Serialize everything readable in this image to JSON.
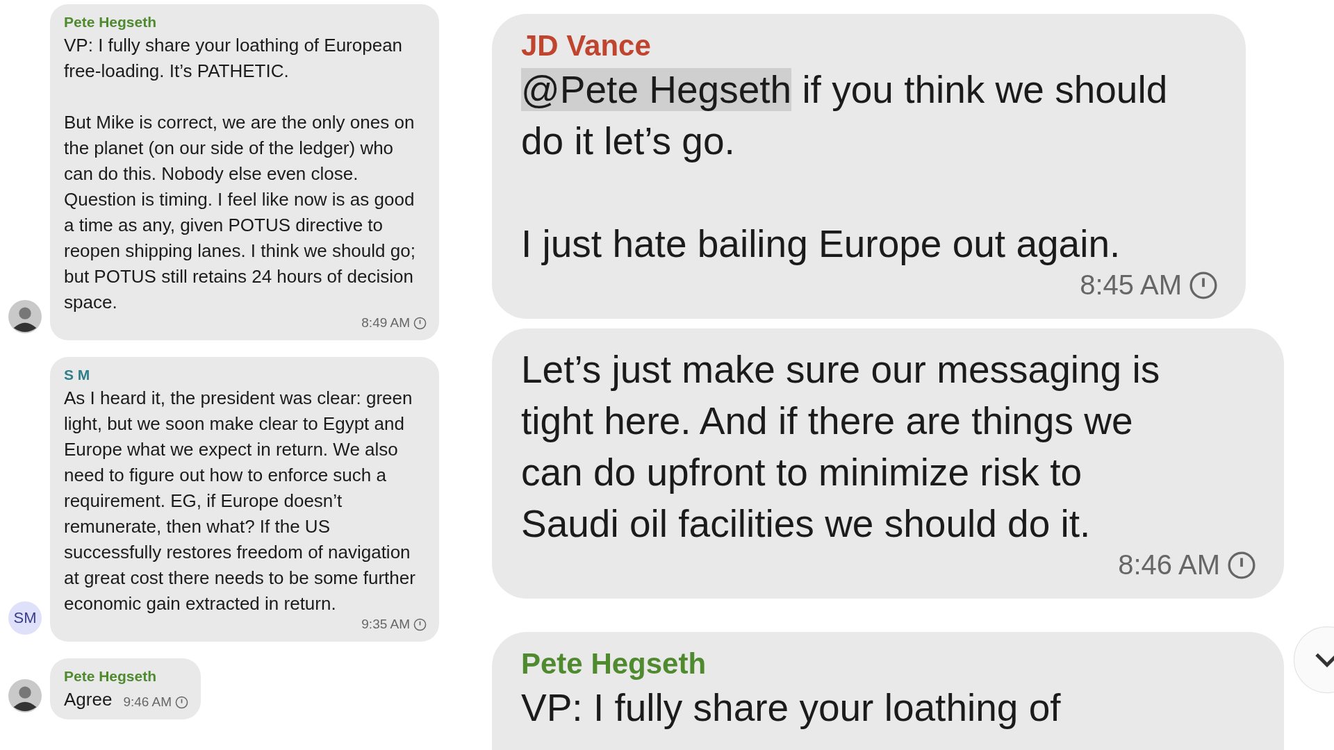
{
  "left_panel": {
    "messages": [
      {
        "sender": "Pete Hegseth",
        "color": "#4f8a2f",
        "paragraphs": [
          "VP: I fully share your loathing of European free-loading. It’s PATHETIC.",
          "But Mike is correct, we are the only ones on the planet (on our side of the ledger) who can do this. Nobody else even close. Question is timing. I feel like now is as good a time as any, given POTUS directive to reopen shipping lanes. I think we should go; but POTUS still retains 24 hours of decision space."
        ],
        "time": "8:49 AM",
        "avatar": {
          "kind": "photo"
        }
      },
      {
        "sender": "S M",
        "color": "#2f7f8a",
        "paragraphs": [
          "As I heard it, the president was clear: green light, but we soon make clear to Egypt and Europe what we expect in return. We also need to figure out how to enforce such a requirement. EG, if Europe doesn’t remunerate, then what? If the US successfully restores freedom of navigation at great cost there needs to be some further economic gain extracted in return."
        ],
        "time": "9:35 AM",
        "avatar": {
          "kind": "initials",
          "initials": "SM"
        }
      },
      {
        "sender": "Pete Hegseth",
        "color": "#4f8a2f",
        "paragraphs": [
          "Agree"
        ],
        "time": "9:46 AM",
        "avatar": {
          "kind": "photo"
        }
      }
    ]
  },
  "right_panel": {
    "messages": [
      {
        "sender": "JD Vance",
        "color": "#c0452f",
        "mention": "@Pete Hegseth",
        "paragraphs": [
          "if you think we should do it let’s go.",
          "I just hate bailing Europe out again."
        ],
        "time": "8:45 AM"
      },
      {
        "paragraphs": [
          "Let’s just make sure our messaging is tight here. And if there are things we can do upfront to minimize risk to Saudi oil facilities we should do it."
        ],
        "time": "8:46 AM"
      },
      {
        "sender": "Pete Hegseth",
        "color": "#4f8a2f",
        "paragraphs": [
          "VP: I fully share your loathing of"
        ]
      }
    ]
  }
}
